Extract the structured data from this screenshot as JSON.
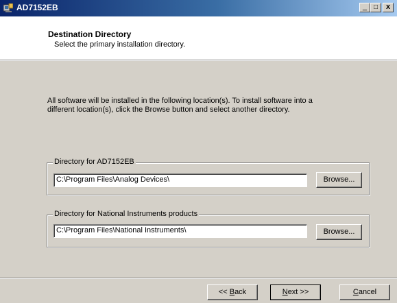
{
  "window": {
    "title": "AD7152EB",
    "min_symbol": "_",
    "max_symbol": "□",
    "close_symbol": "x"
  },
  "header": {
    "title": "Destination Directory",
    "subtitle": "Select the primary installation directory."
  },
  "info": {
    "text": "All software will be installed in the following location(s). To install software into a different location(s), click the Browse button and select another directory."
  },
  "groups": [
    {
      "legend": "Directory for AD7152EB",
      "path": "C:\\Program Files\\Analog Devices\\",
      "browse_label": "Browse..."
    },
    {
      "legend": "Directory for National Instruments products",
      "path": "C:\\Program Files\\National Instruments\\",
      "browse_label": "Browse..."
    }
  ],
  "buttons": {
    "back_prefix": "<< ",
    "back_accel": "B",
    "back_rest": "ack",
    "next_accel": "N",
    "next_rest": "ext >>",
    "cancel_accel": "C",
    "cancel_rest": "ancel"
  },
  "colors": {
    "titlebar_start": "#0a246a",
    "titlebar_end": "#a6caf0",
    "face": "#d4d0c8"
  },
  "icons": {
    "app": "installer-app-icon",
    "minimize": "minimize-icon",
    "maximize": "maximize-icon",
    "close": "close-icon"
  }
}
